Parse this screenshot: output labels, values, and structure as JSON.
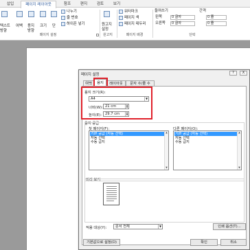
{
  "ribbon": {
    "tabs": [
      {
        "label": "삽입",
        "active": false
      },
      {
        "label": "페이지 레이아웃",
        "active": true
      },
      {
        "label": "참조",
        "active": false
      },
      {
        "label": "편지",
        "active": false
      },
      {
        "label": "검토",
        "active": false
      },
      {
        "label": "보기",
        "active": false
      }
    ],
    "buttons": {
      "text_direction": "텍스트\n방향",
      "margins": "여백",
      "orientation": "용지\n방향",
      "size": "크기",
      "columns": "단",
      "breaks": "나누기",
      "line_numbers": "줄 번호",
      "hyphenation": "하이픈 넣기",
      "manuscript": "원고지\n설정",
      "watermark": "워터마크",
      "page_color": "페이지 색",
      "page_borders": "페이지 테두리",
      "indent_label": "들여쓰기",
      "indent_left_label": "왼쪽",
      "indent_left_value": "0 글자",
      "indent_right_label": "오른쪽",
      "indent_right_value": "0 글자",
      "spacing_label": "간격",
      "spacing_before_value": "0 줄",
      "spacing_after_value": "0 줄"
    },
    "groups": {
      "page_setup": "페이지 설정",
      "manuscript": "원고지",
      "page_background": "페이지 배경",
      "paragraph": "단락"
    }
  },
  "dialog": {
    "title": "페이지 설정",
    "help": "?",
    "close": "X",
    "tabs": [
      {
        "label": "여백",
        "selected": false
      },
      {
        "label": "용지",
        "selected": true
      },
      {
        "label": "레이아웃",
        "selected": false
      },
      {
        "label": "문자 수/줄 수",
        "selected": false
      }
    ],
    "paper_size": {
      "label": "용지 크기(R):",
      "value": "A4",
      "width_label": "너비(W):",
      "width_value": "21 cm",
      "height_label": "높이(E):",
      "height_value": "29.7 cm"
    },
    "paper_source": {
      "label": "용지 공급",
      "first_page_label": "첫 페이지(F):",
      "other_pages_label": "다른 페이지(O):",
      "first_page_items": [
        "기본 공급 (자동 선택)",
        "자동 선택",
        "수동 급지"
      ],
      "other_pages_items": [
        "기본 공급 (자동 선택)",
        "자동 선택",
        "수동 급지"
      ]
    },
    "preview_label": "미리 보기",
    "apply_to": {
      "label": "적용 대상(Y):",
      "value": "문서 전체"
    },
    "print_options_button": "인쇄 옵션(T)...",
    "set_default_button": "기본값으로 설정(D)",
    "ok_button": "확인",
    "cancel_button": "취소"
  },
  "colors": {
    "highlight": "#e0202a",
    "selection": "#3399ff",
    "ribbon_active": "#2b579a"
  }
}
